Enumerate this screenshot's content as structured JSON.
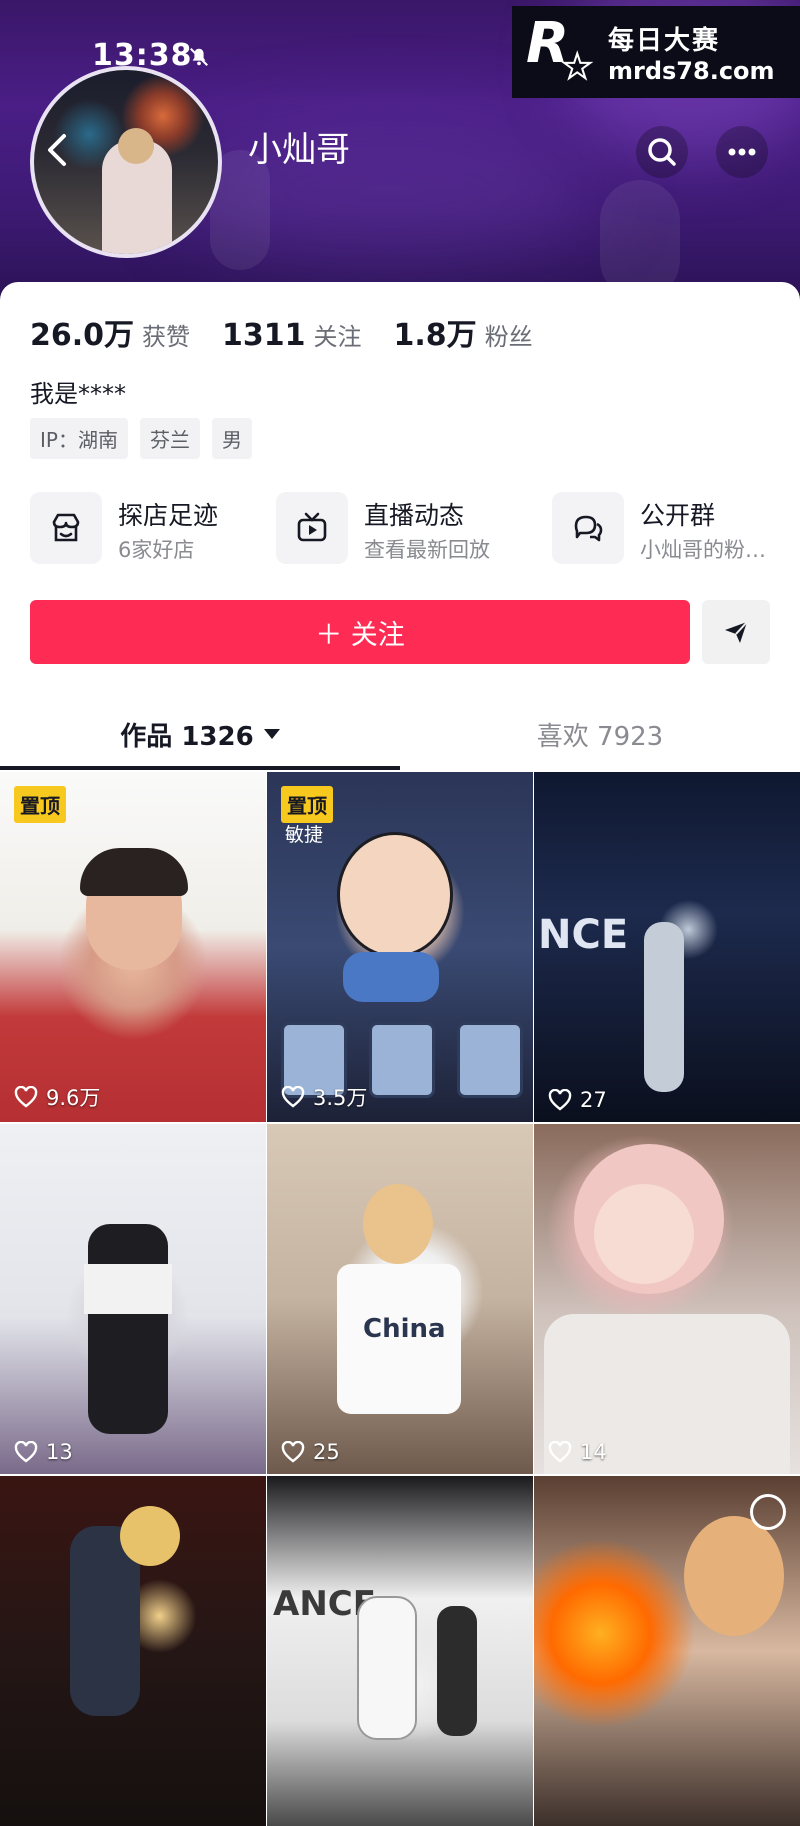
{
  "status_bar": {
    "time": "13:38"
  },
  "watermark": {
    "title": "每日大赛",
    "url": "mrds78.com",
    "logo_letter": "R"
  },
  "profile": {
    "name": "小灿哥",
    "stats": [
      {
        "value": "26.0万",
        "label": "获赞"
      },
      {
        "value": "1311",
        "label": "关注"
      },
      {
        "value": "1.8万",
        "label": "粉丝"
      }
    ],
    "bio": "我是****",
    "tags": [
      "IP：湖南",
      "芬兰",
      "男"
    ]
  },
  "features": [
    {
      "title": "探店足迹",
      "subtitle": "6家好店",
      "icon": "store-icon"
    },
    {
      "title": "直播动态",
      "subtitle": "查看最新回放",
      "icon": "tv-icon"
    },
    {
      "title": "公开群",
      "subtitle": "小灿哥的粉…",
      "icon": "chat-icon"
    }
  ],
  "follow_button": "＋ 关注",
  "tabs": [
    {
      "label": "作品 1326",
      "active": true
    },
    {
      "label": "喜欢 7923",
      "active": false
    }
  ],
  "pin_label": "置顶",
  "videos": [
    {
      "likes": "9.6万",
      "pinned": true
    },
    {
      "likes": "3.5万",
      "pinned": true,
      "caption": "敏捷"
    },
    {
      "likes": "27",
      "pinned": false,
      "overlay": "NCE"
    },
    {
      "likes": "13",
      "pinned": false
    },
    {
      "likes": "25",
      "pinned": false,
      "overlay": "China"
    },
    {
      "likes": "14",
      "pinned": false
    },
    {
      "likes": "",
      "pinned": false
    },
    {
      "likes": "",
      "pinned": false,
      "overlay": "ANCE"
    },
    {
      "likes": "",
      "pinned": false
    }
  ],
  "colors": {
    "accent": "#fe2c55",
    "pin": "#f7c81e",
    "header": "#3d1a73"
  }
}
